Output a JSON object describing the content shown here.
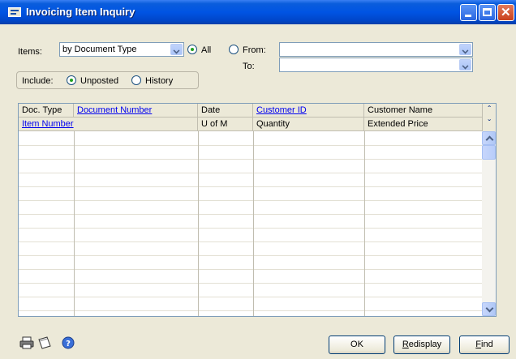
{
  "window": {
    "title": "Invoicing Item Inquiry"
  },
  "filters": {
    "items_label": "Items:",
    "items_value": "by Document Type",
    "all_label": "All",
    "from_label": "From:",
    "to_label": "To:",
    "from_value": "",
    "to_value": "",
    "include_label": "Include:",
    "unposted_label": "Unposted",
    "history_label": "History"
  },
  "grid": {
    "header_row1": [
      "Doc. Type",
      "Document Number",
      "Date",
      "Customer ID",
      "Customer Name"
    ],
    "header_row2": [
      "Item Number",
      "",
      "U of M",
      "Quantity",
      "Extended Price"
    ]
  },
  "buttons": {
    "ok": "OK",
    "redisplay": "Redisplay",
    "find": "Find"
  },
  "icons": [
    "printer-icon",
    "note-icon",
    "help-icon"
  ]
}
